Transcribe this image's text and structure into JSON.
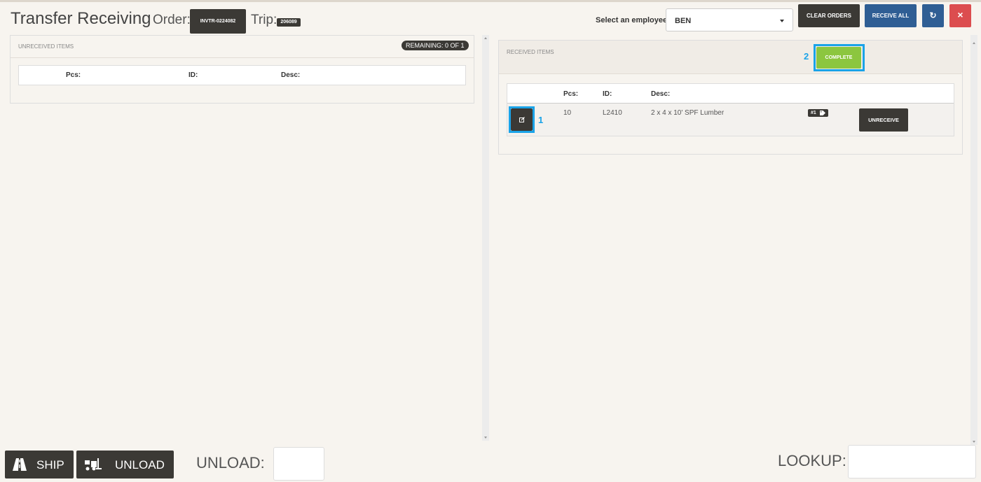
{
  "header": {
    "title": "Transfer Receiving",
    "order_label": "Order:",
    "order_value": "INVTR-0224082",
    "trip_label": "Trip:",
    "trip_value": "206089",
    "employee_label": "Select an employee:",
    "employee_value": "BEN",
    "clear_orders": "CLEAR ORDERS",
    "receive_all": "RECEIVE ALL",
    "refresh_icon": "↻",
    "close_icon": "×"
  },
  "unreceived": {
    "heading": "UNRECEIVED ITEMS",
    "remaining": "REMAINING: 0 OF 1",
    "columns": [
      "Pcs:",
      "ID:",
      "Desc:"
    ]
  },
  "received": {
    "heading": "RECEIVED ITEMS",
    "complete_label": "COMPLETE",
    "columns": [
      "Pcs:",
      "ID:",
      "Desc:"
    ],
    "rows": [
      {
        "pcs": "10",
        "id": "L2410",
        "desc": "2 x 4 x 10' SPF Lumber",
        "tag": "#1",
        "action": "UNRECEIVE"
      }
    ]
  },
  "annotations": {
    "one": "1",
    "two": "2"
  },
  "footer": {
    "ship_label": "SHIP",
    "unload_label": "UNLOAD",
    "unload_field_label": "UNLOAD:",
    "lookup_label": "LOOKUP:"
  },
  "colors": {
    "dark": "#3b3935",
    "blue": "#2f5e94",
    "red": "#dc4d4f",
    "green": "#8cc63f",
    "callout": "#1aa3e8"
  }
}
